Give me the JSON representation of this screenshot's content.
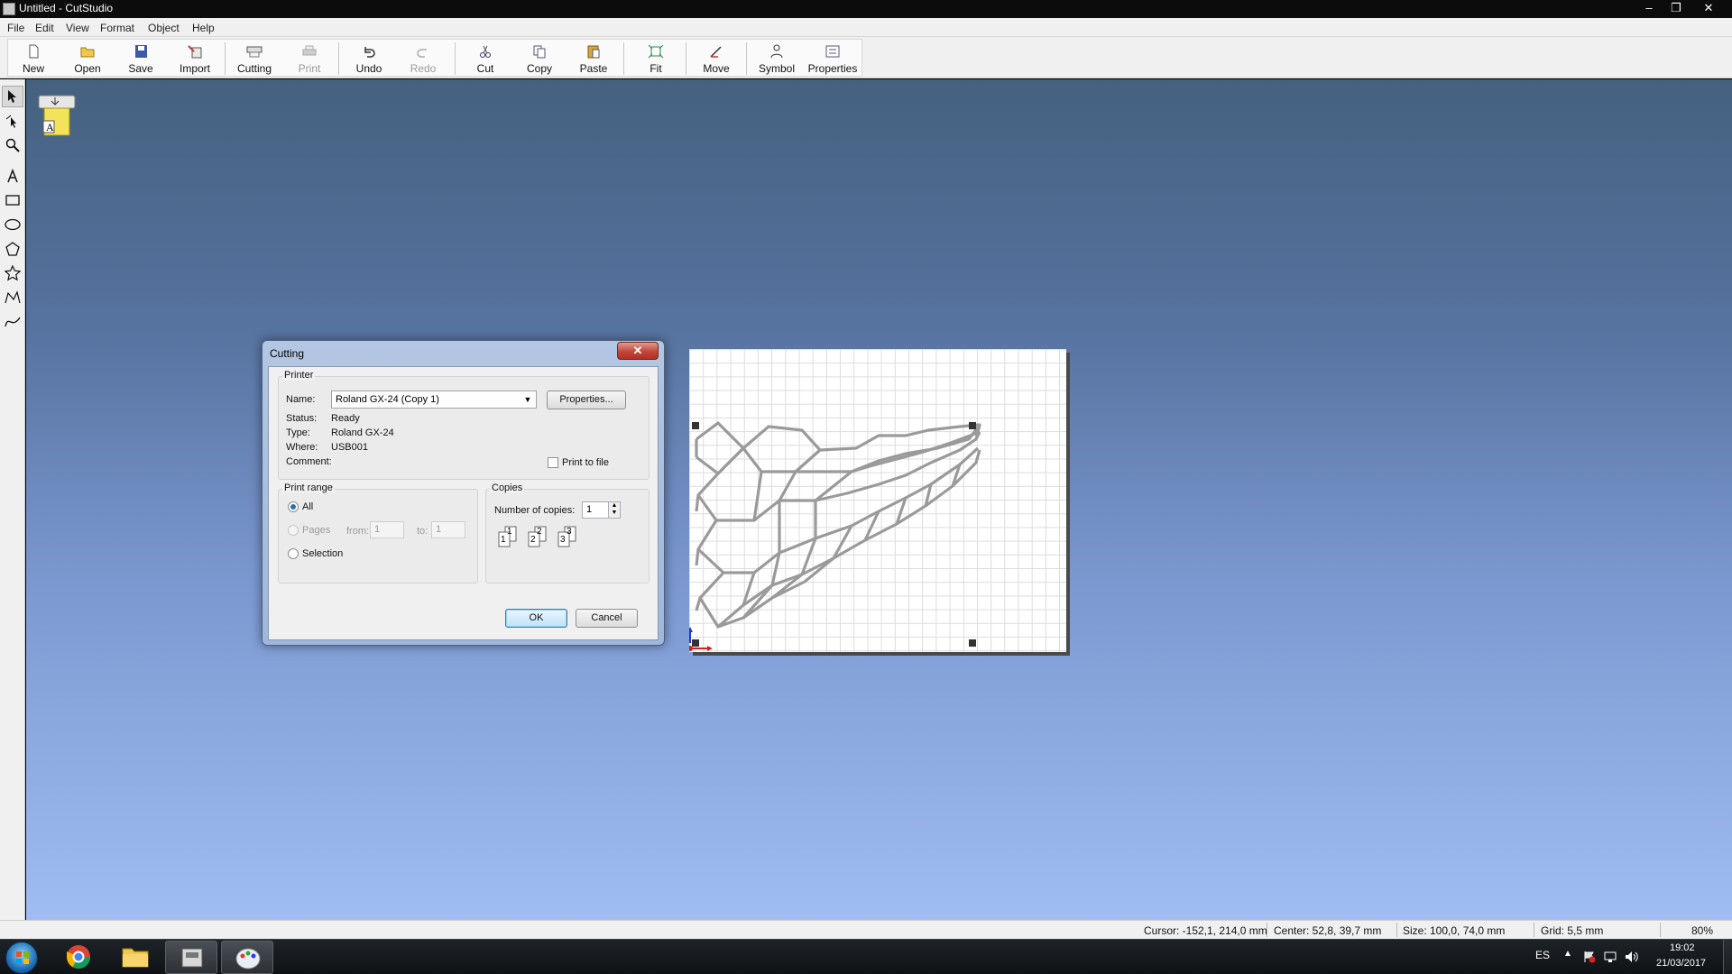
{
  "window": {
    "title": "Untitled - CutStudio",
    "minimize": "–",
    "restore": "❐",
    "close": "✕"
  },
  "menu": [
    "File",
    "Edit",
    "View",
    "Format",
    "Object",
    "Help"
  ],
  "toolbar": {
    "buttons": [
      {
        "label": "New",
        "icon": "new-document-icon"
      },
      {
        "label": "Open",
        "icon": "open-folder-icon"
      },
      {
        "label": "Save",
        "icon": "floppy-disk-icon"
      },
      {
        "label": "Import",
        "icon": "import-icon"
      },
      {
        "label": "Cutting",
        "icon": "cutter-icon"
      },
      {
        "label": "Print",
        "icon": "printer-icon",
        "disabled": true
      },
      {
        "label": "Undo",
        "icon": "undo-icon"
      },
      {
        "label": "Redo",
        "icon": "redo-icon",
        "disabled": true
      },
      {
        "label": "Cut",
        "icon": "scissors-icon"
      },
      {
        "label": "Copy",
        "icon": "copy-icon"
      },
      {
        "label": "Paste",
        "icon": "paste-icon"
      },
      {
        "label": "Fit",
        "icon": "fit-icon"
      },
      {
        "label": "Move",
        "icon": "move-icon"
      },
      {
        "label": "Symbol",
        "icon": "symbol-icon"
      },
      {
        "label": "Properties",
        "icon": "properties-icon"
      }
    ]
  },
  "tools": [
    "select-arrow-icon",
    "edit-points-icon",
    "zoom-icon",
    "text-icon",
    "rectangle-icon",
    "ellipse-icon",
    "polygon-icon",
    "star-icon",
    "polyline-icon",
    "curve-icon"
  ],
  "workspace_icon_label": "A",
  "dialog": {
    "title": "Cutting",
    "close_label": "✕",
    "printer_group": "Printer",
    "name_label": "Name:",
    "printer_name": "Roland GX-24 (Copy 1)",
    "properties_button": "Properties...",
    "status_label": "Status:",
    "status_value": "Ready",
    "type_label": "Type:",
    "type_value": "Roland GX-24",
    "where_label": "Where:",
    "where_value": "USB001",
    "comment_label": "Comment:",
    "print_to_file": "Print to file",
    "print_to_file_checked": false,
    "range_group": "Print range",
    "range_all": "All",
    "range_pages": "Pages",
    "from_label": "from:",
    "from_value": "1",
    "to_label": "to:",
    "to_value": "1",
    "range_selection": "Selection",
    "selected_range": "All",
    "copies_group": "Copies",
    "copies_label": "Number of copies:",
    "copies_value": "1",
    "collate_numbers": [
      "1",
      "1",
      "2",
      "2",
      "3",
      "3"
    ],
    "ok_button": "OK",
    "cancel_button": "Cancel"
  },
  "status_bar": {
    "cursor": "Cursor: -152,1, 214,0 mm",
    "center": "Center: 52,8, 39,7 mm",
    "size": "Size: 100,0, 74,0 mm",
    "grid": "Grid: 5,5 mm",
    "zoom": "80%"
  },
  "taskbar": {
    "apps": [
      "start-orb-icon",
      "chrome-icon",
      "file-explorer-icon",
      "cutstudio-icon",
      "paint-icon"
    ],
    "language": "ES",
    "time": "19:02",
    "date": "21/03/2017"
  }
}
